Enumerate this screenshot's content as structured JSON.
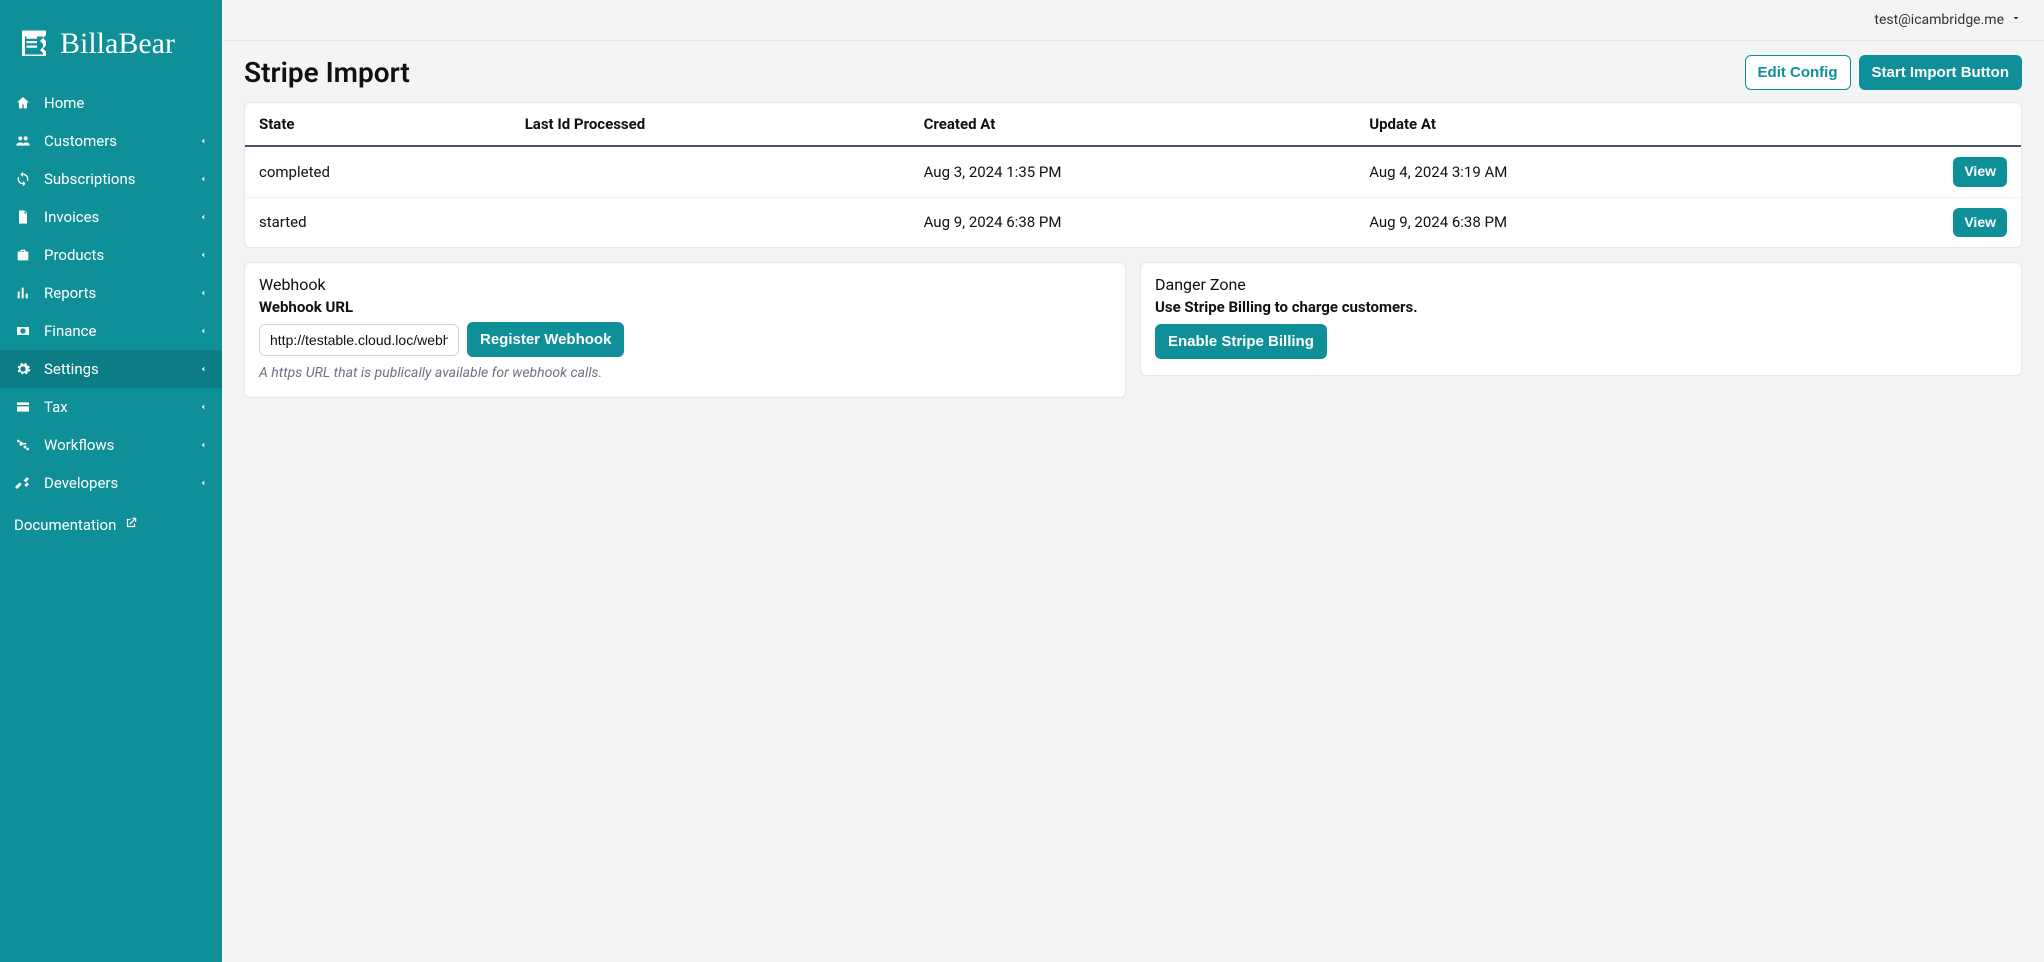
{
  "brand": {
    "name": "BillaBear"
  },
  "user": {
    "email": "test@icambridge.me"
  },
  "sidebar": {
    "items": [
      {
        "label": "Home",
        "icon": "home",
        "expandable": false,
        "active": false
      },
      {
        "label": "Customers",
        "icon": "users",
        "expandable": true,
        "active": false
      },
      {
        "label": "Subscriptions",
        "icon": "sync",
        "expandable": true,
        "active": false
      },
      {
        "label": "Invoices",
        "icon": "file",
        "expandable": true,
        "active": false
      },
      {
        "label": "Products",
        "icon": "briefcase",
        "expandable": true,
        "active": false
      },
      {
        "label": "Reports",
        "icon": "bar-chart",
        "expandable": true,
        "active": false
      },
      {
        "label": "Finance",
        "icon": "cash",
        "expandable": true,
        "active": false
      },
      {
        "label": "Settings",
        "icon": "gear",
        "expandable": true,
        "active": true
      },
      {
        "label": "Tax",
        "icon": "card",
        "expandable": true,
        "active": false
      },
      {
        "label": "Workflows",
        "icon": "workflow",
        "expandable": true,
        "active": false
      },
      {
        "label": "Developers",
        "icon": "tools",
        "expandable": true,
        "active": false
      }
    ],
    "doc_link": "Documentation"
  },
  "page": {
    "title": "Stripe Import",
    "edit_config": "Edit Config",
    "start_import": "Start Import Button"
  },
  "table": {
    "headers": {
      "state": "State",
      "last_id": "Last Id Processed",
      "created": "Created At",
      "updated": "Update At"
    },
    "view_label": "View",
    "rows": [
      {
        "state": "completed",
        "last_id": "",
        "created": "Aug 3, 2024 1:35 PM",
        "updated": "Aug 4, 2024 3:19 AM"
      },
      {
        "state": "started",
        "last_id": "",
        "created": "Aug 9, 2024 6:38 PM",
        "updated": "Aug 9, 2024 6:38 PM"
      }
    ]
  },
  "webhook": {
    "heading": "Webhook",
    "label": "Webhook URL",
    "value": "http://testable.cloud.loc/webhook",
    "register": "Register Webhook",
    "help": "A https URL that is publically available for webhook calls."
  },
  "danger": {
    "heading": "Danger Zone",
    "desc": "Use Stripe Billing to charge customers.",
    "button": "Enable Stripe Billing"
  }
}
